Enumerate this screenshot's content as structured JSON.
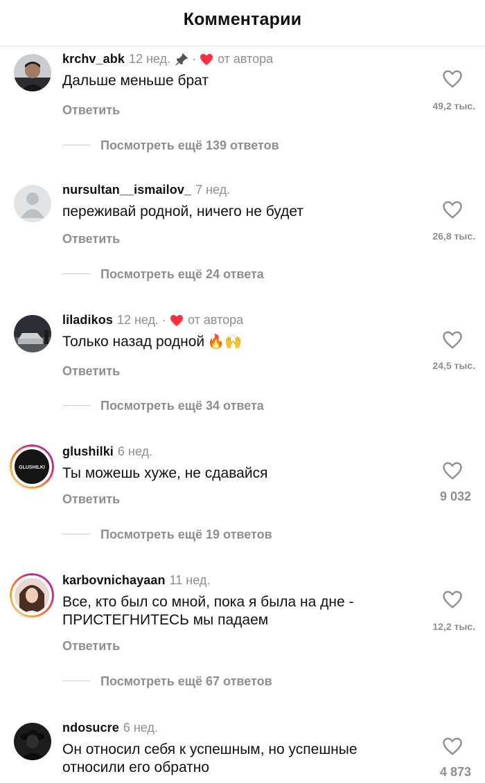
{
  "header": {
    "title": "Комментарии"
  },
  "labels": {
    "reply": "Ответить",
    "by_author": "от автора"
  },
  "comments": [
    {
      "username": "krchv_abk",
      "time": "12 нед.",
      "pinned": true,
      "liked_by_author": true,
      "text": "Дальше меньше брат",
      "likes": "49,2 тыс.",
      "view_replies": "Посмотреть ещё 139 ответов"
    },
    {
      "username": "nursultan__ismailov_",
      "time": "7 нед.",
      "pinned": false,
      "liked_by_author": false,
      "text": "переживай родной, ничего не будет",
      "likes": "26,8 тыс.",
      "view_replies": "Посмотреть ещё 24 ответа"
    },
    {
      "username": "liladikos",
      "time": "12 нед.",
      "pinned": false,
      "liked_by_author": true,
      "text": "Только назад родной",
      "emoji": "🔥🙌",
      "likes": "24,5 тыс.",
      "view_replies": "Посмотреть ещё 34 ответа"
    },
    {
      "username": "glushilki",
      "time": "6 нед.",
      "pinned": false,
      "liked_by_author": false,
      "avatar_text": "GLUSHILKI",
      "text": "Ты можешь хуже, не сдавайся",
      "likes": "9 032",
      "view_replies": "Посмотреть ещё 19 ответов"
    },
    {
      "username": "karbovnichayaan",
      "time": "11 нед.",
      "pinned": false,
      "liked_by_author": false,
      "text": "Все, кто был со мной, пока я была на дне - ПРИСТЕГНИТЕСЬ мы падаем",
      "likes": "12,2 тыс.",
      "view_replies": "Посмотреть ещё 67 ответов"
    },
    {
      "username": "ndosucre",
      "time": "6 нед.",
      "pinned": false,
      "liked_by_author": false,
      "text": "Он относил себя к успешным, но успешные относили его обратно",
      "likes": "4 873"
    }
  ],
  "colors": {
    "heart_red": "#ff2f40",
    "muted": "#8e8e8e",
    "story_ring": "#e1306c"
  }
}
